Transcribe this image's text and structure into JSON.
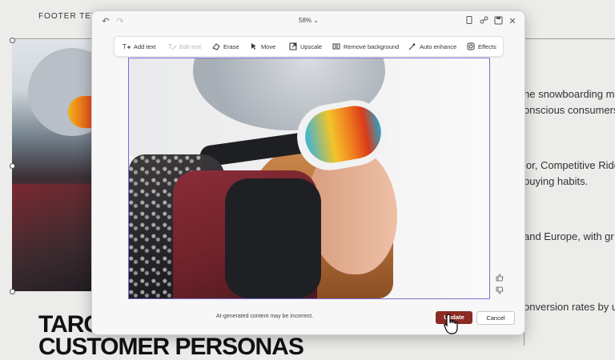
{
  "slide": {
    "footer_text": "FOOTER TEXT",
    "body_lines": [
      "he snowboarding m",
      "onscious consumers",
      "lor, Competitive Ride",
      "buying habits.",
      "and Europe, with gr",
      "onversion rates by u"
    ],
    "heading_line1": "TARGET MARKET AND",
    "heading_line2": "CUSTOMER PERSONAS"
  },
  "dialog": {
    "zoom": "58%",
    "icons": {
      "undo": "undo-icon",
      "redo": "redo-icon",
      "copy": "copy-icon",
      "share": "share-icon",
      "save": "save-icon",
      "close": "close-icon"
    },
    "toolbar": [
      {
        "label": "Add text",
        "icon": "add-text-icon",
        "enabled": true
      },
      {
        "label": "Edit text",
        "icon": "edit-text-icon",
        "enabled": false
      },
      {
        "label": "Erase",
        "icon": "erase-icon",
        "enabled": true
      },
      {
        "label": "Move",
        "icon": "move-icon",
        "enabled": true
      },
      {
        "label": "Upscale",
        "icon": "upscale-icon",
        "enabled": true
      },
      {
        "label": "Remove background",
        "icon": "remove-background-icon",
        "enabled": true
      },
      {
        "label": "Auto enhance",
        "icon": "auto-enhance-icon",
        "enabled": true
      },
      {
        "label": "Effects",
        "icon": "effects-icon",
        "enabled": true
      }
    ],
    "disclaimer": "AI-generated content may be incorrect.",
    "update_label": "Update",
    "cancel_label": "Cancel"
  },
  "colors": {
    "accent": "#8b2b24",
    "selection": "#7b6fd6"
  }
}
